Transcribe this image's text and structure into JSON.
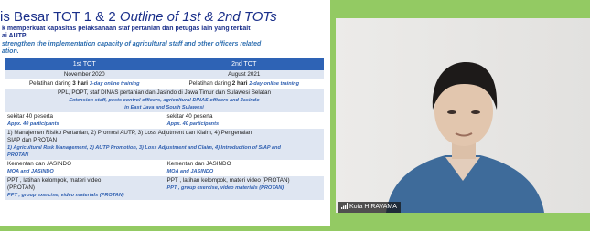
{
  "slide": {
    "title_main": "is Besar TOT 1 & 2",
    "title_italic": "Outline of 1st & 2nd TOTs",
    "objective_id_line1": "k memperkuat kapasitas pelaksanaan staf pertanian dan petugas lain yang terkait",
    "objective_id_line2": "ai AUTP.",
    "objective_en_line1": "strengthen the implementation capacity of agricultural staff and other officers related",
    "objective_en_line2": "ation.",
    "columns": [
      "1st TOT",
      "2nd TOT"
    ],
    "rows": {
      "dates": [
        "November 2020",
        "August 2021"
      ],
      "training": {
        "left_pre": "Pelatihan daring ",
        "left_bold": "3 hari",
        "left_en": "3-day online training",
        "right_pre": "Pelatihan daring ",
        "right_bold": "2 hari",
        "right_en": "2-day online training"
      },
      "participants_merged": {
        "line1": "PPL, POPT, staf DINAS pertanian dan Jasindo di Jawa Timur dan Sulawesi Selatan",
        "line2": "Extension staff, pests control officers, agricultural DINAS officers and Jasindo",
        "line3": "in East Java and South Sulawesi"
      },
      "count": {
        "left": "sekitar 40 peserta",
        "left_en": "Appx. 40 participants",
        "right": "sekitar 40 peserta",
        "right_en": "Appx. 40 participants"
      },
      "topics_merged": {
        "line1": "1)  Manajemen Risiko Pertanian, 2) Promosi AUTP, 3) Loss Adjutment dan Klaim, 4) Pengenalan",
        "line2": "SIAP dan PROTAN",
        "line3": "1) Agricultural Risk Management, 2) AUTP Promotion, 3) Loss Adjustment and Claim, 4) Introduction of SIAP and",
        "line4": "PROTAN"
      },
      "lecturers": {
        "left": "Kementan dan JASINDO",
        "left_en": "MOA and JASINDO",
        "right": "Kementan dan JASINDO",
        "right_en": "MOA and JASINDO"
      },
      "methods": {
        "left_1": "PPT , latihan kelompok, materi video",
        "left_2": "(PROTAN)",
        "left_en": "PPT , group exercise, video materials (PROTAN)",
        "right_1": "PPT , latihan kelompok, materi video (PROTAN)",
        "right_en": "PPT , group exercise, video materials (PROTAN)"
      }
    }
  },
  "participant_video": {
    "name": "Kota H RAVAMA",
    "signal_icon": "signal-bars-icon"
  },
  "colors": {
    "background": "#93ca63",
    "table_header": "#2e63b5",
    "title_blue": "#1a2f8a",
    "english_blue": "#2f5fb0",
    "row_shade": "#dfe6f2"
  }
}
